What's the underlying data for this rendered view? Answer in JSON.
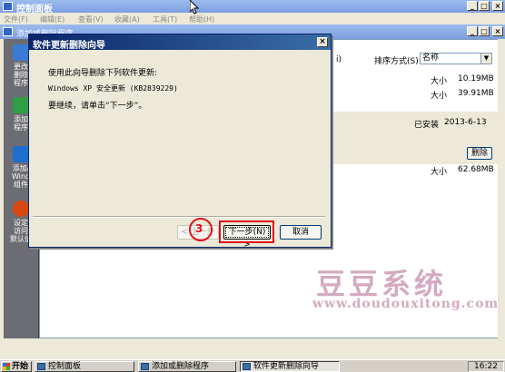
{
  "control_panel": {
    "title": "控制面板",
    "menu": [
      "文件(F)",
      "编辑(E)",
      "查看(V)",
      "收藏(A)",
      "工具(T)",
      "帮助(H)"
    ]
  },
  "add_remove": {
    "title": "添加或删除程序",
    "sidebar": [
      {
        "label": "更改\n删除\n程序",
        "icon": "change-remove-programs-icon",
        "color": "#3a7bd5"
      },
      {
        "label": "添加\n程序",
        "icon": "add-programs-icon",
        "color": "#2f9e44"
      },
      {
        "label": "添加/\nWind\n组件",
        "icon": "windows-components-icon",
        "color": "#1f6fd1"
      },
      {
        "label": "设定\n访问\n默认值",
        "icon": "set-defaults-icon",
        "color": "#d9480f"
      }
    ],
    "partial_label": "i)",
    "sort_label": "排序方式(S):",
    "sort_value": "名称",
    "rows": [
      {
        "label": "大小",
        "value": "10.19MB"
      },
      {
        "label": "大小",
        "value": "39.91MB"
      },
      {
        "label": "已安装",
        "value": "2013-6-13"
      },
      {
        "label": "大小",
        "value": "62.68MB"
      }
    ],
    "remove_button": "删除",
    "watermark_title": "豆豆系统",
    "watermark_url": "www.doudouxitong.com"
  },
  "dialog": {
    "title": "软件更新删除向导",
    "line1": "使用此向导删除下列软件更新:",
    "line2": "Windows XP 安全更新 (KB2839229)",
    "line3": "要继续，请单击“下一步”。",
    "back_button": "< 上一步",
    "next_button": "下一步(N) >",
    "cancel_button": "取消",
    "step_number": "3"
  },
  "taskbar": {
    "start": "开始",
    "tasks": [
      "控制面板",
      "添加或删除程序",
      "软件更新删除向导"
    ],
    "clock": "16:22"
  },
  "colors": {
    "title_blue": "#7d9ee0",
    "dialog_title": "#0a246a",
    "highlight_red": "#e0101e",
    "watermark": "#d4aac0"
  }
}
